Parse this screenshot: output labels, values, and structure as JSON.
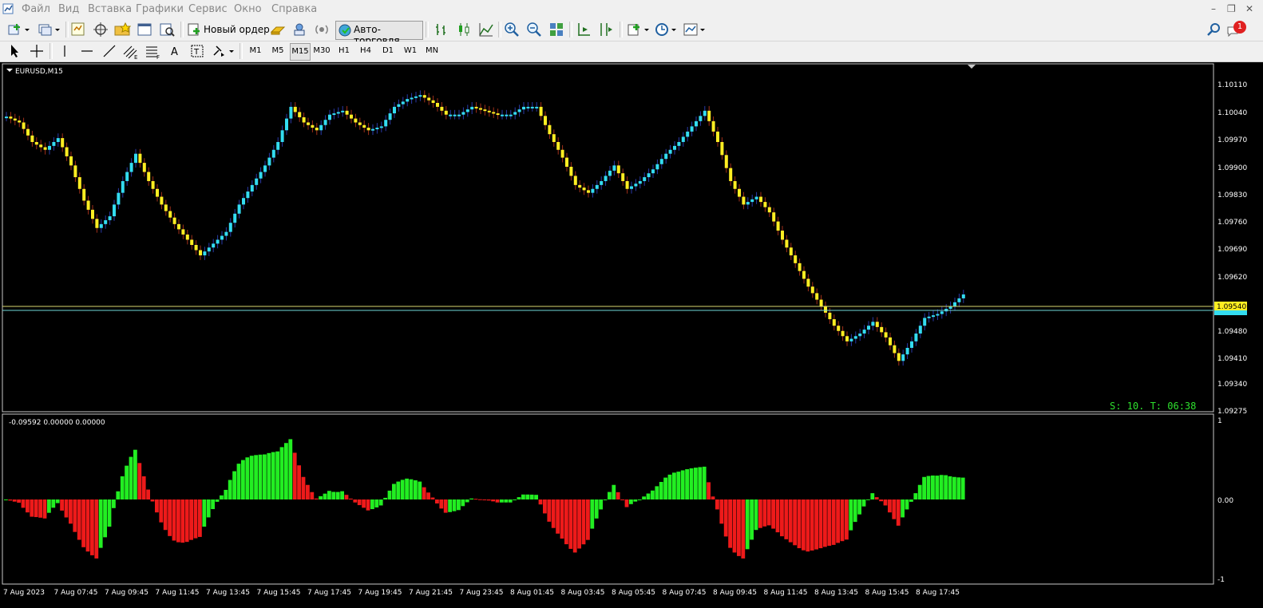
{
  "menu": {
    "items": [
      "Файл",
      "Вид",
      "Вставка",
      "Графики",
      "Сервис",
      "Окно",
      "Справка"
    ]
  },
  "toolbar": {
    "new_order_label": "Новый ордер",
    "auto_trading_label": "Авто-торговля",
    "notification_count": "1"
  },
  "timeframes": {
    "items": [
      "M1",
      "M5",
      "M15",
      "M30",
      "H1",
      "H4",
      "D1",
      "W1",
      "MN"
    ],
    "active": "M15"
  },
  "chart": {
    "symbol_label": "EURUSD,M15",
    "price_axis": [
      "1.10110",
      "1.10040",
      "1.09970",
      "1.09900",
      "1.09830",
      "1.09760",
      "1.09690",
      "1.09620",
      "1.09480",
      "1.09410",
      "1.09340",
      "1.09275"
    ],
    "current_price": "1.09540",
    "status_text": "S: 10. T: 06:38",
    "colors": {
      "bull": "#33dcf0",
      "bear": "#ffee22",
      "bg": "#000000",
      "up_bar": "#22ee22",
      "down_bar": "#ee1a1a"
    },
    "time_axis": [
      "7 Aug 2023",
      "7 Aug 07:45",
      "7 Aug 09:45",
      "7 Aug 11:45",
      "7 Aug 13:45",
      "7 Aug 15:45",
      "7 Aug 17:45",
      "7 Aug 19:45",
      "7 Aug 21:45",
      "7 Aug 23:45",
      "8 Aug 01:45",
      "8 Aug 03:45",
      "8 Aug 05:45",
      "8 Aug 07:45",
      "8 Aug 09:45",
      "8 Aug 11:45",
      "8 Aug 13:45",
      "8 Aug 15:45",
      "8 Aug 17:45"
    ]
  },
  "indicator": {
    "values_label": "-0.09592 0.00000 0.00000",
    "axis": [
      "1",
      "0.00",
      "-1"
    ]
  },
  "chart_data": {
    "type": "candlestick+histogram",
    "price_close_points": [
      1.10015,
      1.1,
      1.0995,
      1.0993,
      1.0996,
      1.0989,
      1.098,
      1.0973,
      1.0976,
      1.0985,
      1.0992,
      1.0985,
      1.0979,
      1.0974,
      1.097,
      1.0966,
      1.0969,
      1.0972,
      1.0979,
      1.0984,
      1.0989,
      1.0995,
      1.1004,
      1.1,
      1.0998,
      1.1002,
      1.1003,
      1.1,
      1.0998,
      1.0999,
      1.1004,
      1.1006,
      1.1007,
      1.1005,
      1.1002,
      1.1002,
      1.1004,
      1.1003,
      1.1002,
      1.1002,
      1.1004,
      1.1004,
      1.0997,
      1.0991,
      1.0984,
      1.0982,
      1.0985,
      1.0989,
      1.0983,
      1.0985,
      1.0988,
      1.0992,
      1.0995,
      1.0999,
      1.1003,
      1.0995,
      1.0985,
      1.0979,
      1.0981,
      1.0977,
      1.097,
      1.0964,
      1.0958,
      1.0953,
      1.0948,
      1.0944,
      1.0946,
      1.0949,
      1.0945,
      1.0939,
      1.0944,
      1.095,
      1.0951,
      1.0953,
      1.0956
    ]
  }
}
